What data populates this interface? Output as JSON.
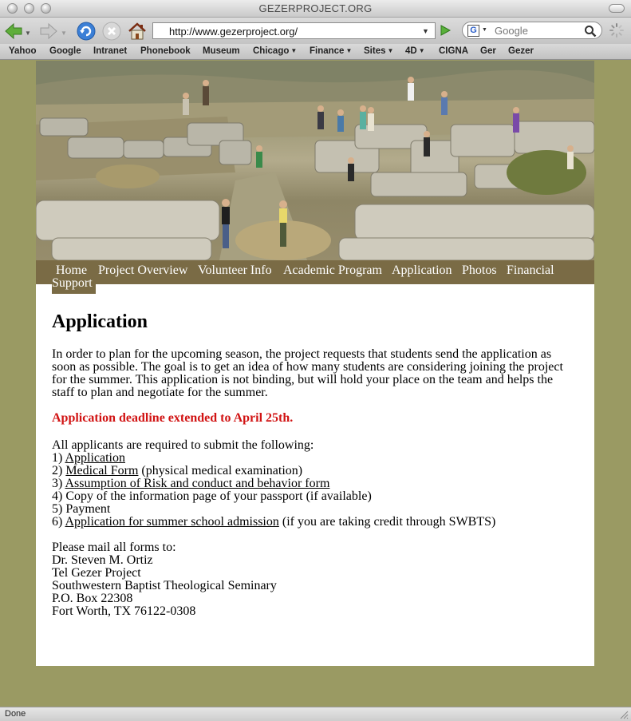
{
  "window": {
    "title": "GEZERPROJECT.ORG"
  },
  "toolbar": {
    "url": "http://www.gezerproject.org/",
    "search_placeholder": "Google",
    "search_engine_letter": "G"
  },
  "bookmarks": [
    {
      "label": "Yahoo",
      "has_menu": false
    },
    {
      "label": "Google",
      "has_menu": false
    },
    {
      "label": "Intranet",
      "has_menu": false
    },
    {
      "label": "Phonebook",
      "has_menu": false
    },
    {
      "label": "Museum",
      "has_menu": false
    },
    {
      "label": "Chicago",
      "has_menu": true
    },
    {
      "label": "Finance",
      "has_menu": true
    },
    {
      "label": "Sites",
      "has_menu": true
    },
    {
      "label": "4D",
      "has_menu": true
    },
    {
      "label": "CIGNA",
      "has_menu": false
    },
    {
      "label": "Ger",
      "has_menu": false
    },
    {
      "label": "Gezer",
      "has_menu": false
    }
  ],
  "nav": {
    "home": "Home",
    "project_overview": "Project Overview",
    "volunteer_info": "Volunteer Info",
    "academic_program": "Academic Program",
    "application": "Application",
    "photos": "Photos",
    "financial": "Financial",
    "support": "Support"
  },
  "content": {
    "heading": "Application",
    "intro": "In order to plan for the upcoming season, the project requests that students send the application as soon as possible. The goal is to get an idea of how many students are considering joining the project for the summer. This application is not binding, but will hold your place on the team and helps the staff to plan and negotiate for the summer.",
    "deadline": "Application deadline extended to April 25th.",
    "requirements_heading": "All applicants are required to submit the following:",
    "requirements": [
      {
        "num": "1) ",
        "link": "Application",
        "after": ""
      },
      {
        "num": "2) ",
        "link": "Medical Form",
        "after": " (physical medical examination)"
      },
      {
        "num": "3) ",
        "link": "Assumption of Risk and conduct and behavior form",
        "after": ""
      },
      {
        "num": "4) ",
        "link": "",
        "after": "Copy of the information page of your passport (if available)"
      },
      {
        "num": "5) ",
        "link": "",
        "after": "Payment"
      },
      {
        "num": "6) ",
        "link": "Application for summer school admission",
        "after": " (if you are taking credit through SWBTS)"
      }
    ],
    "mail_heading": "Please mail all forms to:",
    "address": [
      "Dr. Steven M. Ortiz",
      "Tel Gezer Project",
      "Southwestern Baptist Theological Seminary",
      "P.O. Box 22308",
      "Fort Worth, TX 76122-0308"
    ]
  },
  "status": {
    "text": "Done"
  },
  "colors": {
    "page_bg": "#9a9a63",
    "nav_bg": "#7a6b45",
    "deadline_red": "#d11313"
  }
}
